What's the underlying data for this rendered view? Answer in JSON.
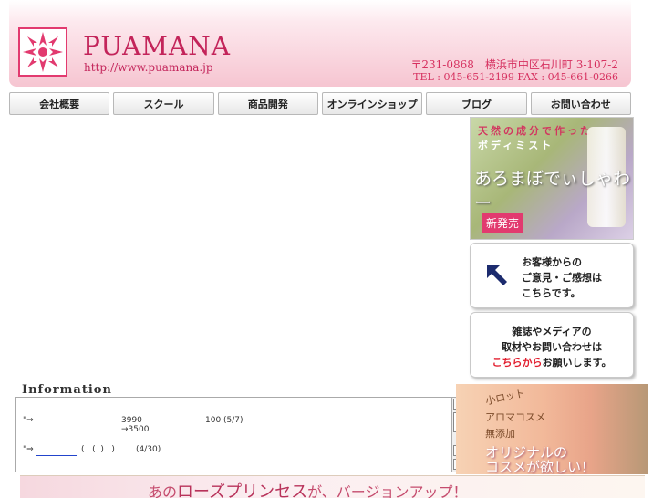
{
  "header": {
    "brand": "PUAMANA",
    "url": "http://www.puamana.jp",
    "address": "〒231-0868　横浜市中区石川町 3-107-2",
    "phone": "TEL : 045-651-2199  FAX : 045-661-0266"
  },
  "nav": {
    "items": [
      "会社概要",
      "スクール",
      "商品開発",
      "オンラインショップ",
      "ブログ",
      "お問い合わせ"
    ]
  },
  "promo": {
    "line1": "天然の成分で作った",
    "line2": "ボディミスト",
    "title": "あろまぼでぃしゃわー",
    "badge": "新発売"
  },
  "feedback": {
    "line1": "お客様からの",
    "line2": "ご意見・ご感想は",
    "line3": "こちらです。"
  },
  "media": {
    "line1": "雑誌やメディアの",
    "line2": "取材やお問い合わせは",
    "link": "こちらから",
    "line3_rest": "お願いします。"
  },
  "information": {
    "title": "Information",
    "rows": [
      {
        "marker": "\"⇒",
        "price": "3990 →3500",
        "value": "100 (5/7)"
      },
      {
        "marker": "\"⇒",
        "link": "　　　　　",
        "paren": "(   (  )   )",
        "date": "(4/30)"
      }
    ]
  },
  "cosme": {
    "l1": "小ロット",
    "l2": "アロマコスメ",
    "l3": "無添加",
    "l4": "オリジナルの",
    "l5": "コスメが欲しい！"
  },
  "rose_banner": {
    "pre": "あの",
    "name": "ローズプリンセス",
    "post": "が、バージョンアップ！"
  },
  "colors": {
    "brand": "#c3245a",
    "accent": "#e23a6f",
    "header_bg": "#f6c5d1"
  }
}
